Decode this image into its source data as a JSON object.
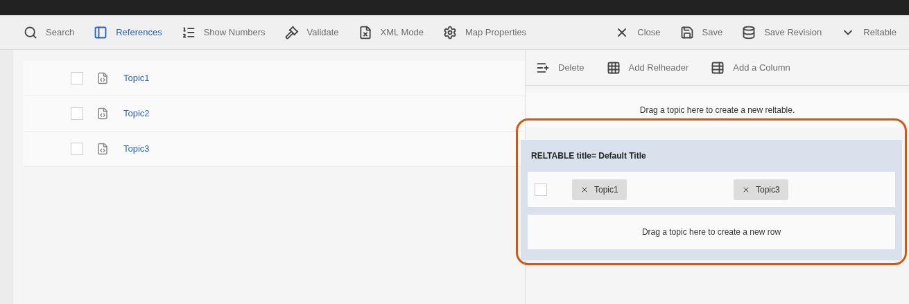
{
  "toolbar": {
    "left": [
      {
        "label": "Search",
        "kind": "search",
        "selected": false
      },
      {
        "label": "References",
        "kind": "panel",
        "selected": true
      },
      {
        "label": "Show Numbers",
        "kind": "numbers",
        "selected": false
      },
      {
        "label": "Validate",
        "kind": "gavel",
        "selected": false
      },
      {
        "label": "XML Mode",
        "kind": "xml",
        "selected": false
      },
      {
        "label": "Map Properties",
        "kind": "gear",
        "selected": false
      }
    ],
    "right": [
      {
        "label": "Close",
        "kind": "close"
      },
      {
        "label": "Save",
        "kind": "save"
      },
      {
        "label": "Save Revision",
        "kind": "database"
      },
      {
        "label": "Reltable",
        "kind": "chevron"
      }
    ]
  },
  "references": [
    {
      "title": "Topic1",
      "checked": false
    },
    {
      "title": "Topic2",
      "checked": false
    },
    {
      "title": "Topic3",
      "checked": false
    }
  ],
  "reltable_toolbar": [
    {
      "label": "Delete",
      "kind": "delete"
    },
    {
      "label": "Add Relheader",
      "kind": "addheader"
    },
    {
      "label": "Add a Column",
      "kind": "addcolumn"
    }
  ],
  "new_reltable_drop": "Drag a topic here to create a new reltable.",
  "reltable": {
    "title": "RELTABLE title= Default Title",
    "highlighted": true,
    "rows": [
      {
        "checked": false,
        "cells": [
          "Topic1",
          "Topic3"
        ]
      }
    ],
    "new_row_drop": "Drag a topic here to create a new row"
  }
}
